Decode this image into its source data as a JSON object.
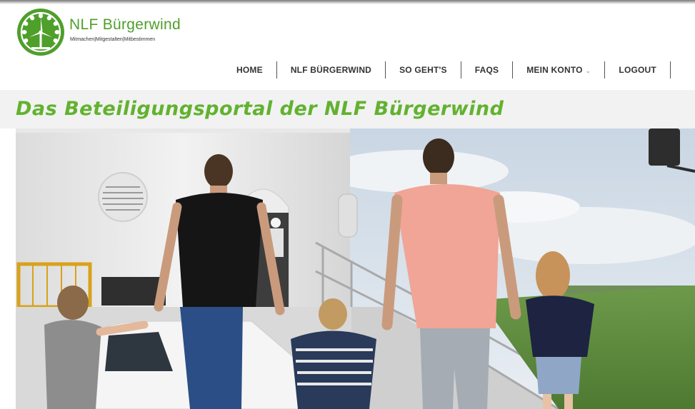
{
  "brand": {
    "name": "NLF Bürgerwind",
    "tagline": "Mitmachen|Mitgestalten|Mitbestimmen",
    "color": "#4f9f2b"
  },
  "nav": {
    "items": [
      {
        "label": "HOME"
      },
      {
        "label": "NLF BÜRGERWIND"
      },
      {
        "label": "SO GEHT'S"
      },
      {
        "label": "FAQS"
      },
      {
        "label": "MEIN KONTO",
        "has_dropdown": true,
        "icon": "chevron-down-icon"
      },
      {
        "label": "LOGOUT"
      }
    ]
  },
  "page": {
    "title": "Das Beteiligungsportal der NLF Bürgerwind",
    "title_color": "#62b22f"
  },
  "hero": {
    "image": "family-walking-to-wind-turbine-photo"
  }
}
